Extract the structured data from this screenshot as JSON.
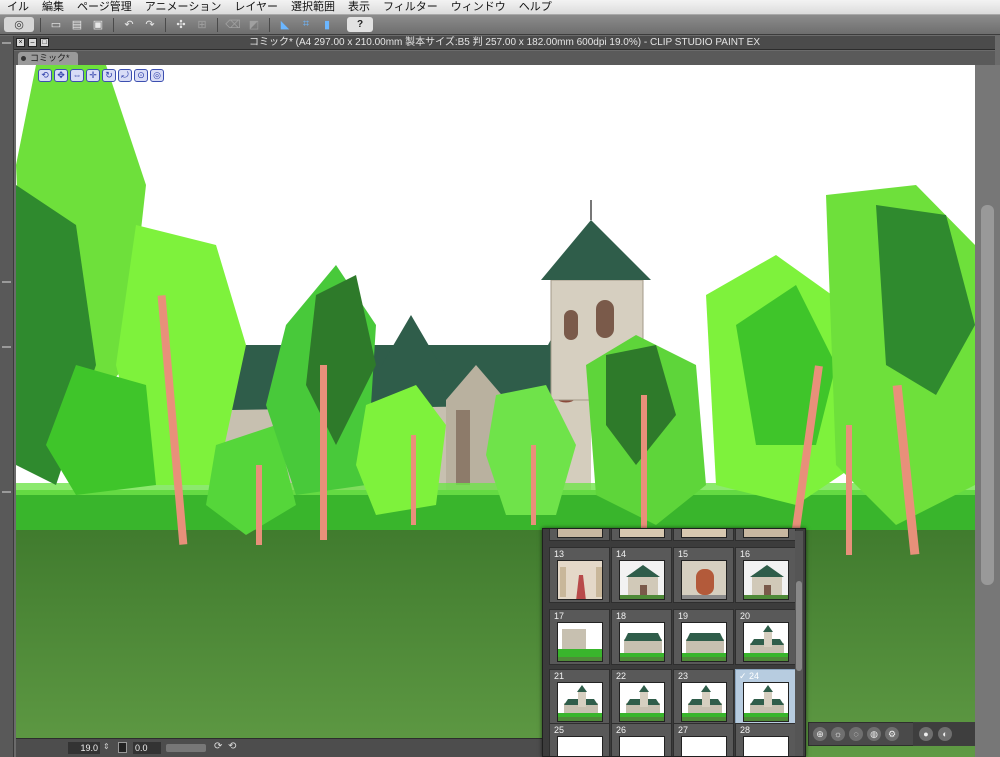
{
  "menubar": {
    "items": [
      "イル",
      "編集",
      "ページ管理",
      "アニメーション",
      "レイヤー",
      "選択範囲",
      "表示",
      "フィルター",
      "ウィンドウ",
      "ヘルプ"
    ]
  },
  "toolbar": {
    "buttons": [
      "app-logo-icon",
      "new-file-icon",
      "open-folder-icon",
      "save-icon",
      "undo-icon",
      "redo-icon",
      "transform-icon",
      "move-icon",
      "clear-icon",
      "fill-icon",
      "snap-ruler-icon",
      "snap-grid-icon",
      "snap-special-icon",
      "help-icon"
    ],
    "help_label": "?"
  },
  "window": {
    "title": "コミック* (A4 297.00 x 210.00mm 製本サイズ:B5 判 257.00 x 182.00mm 600dpi 19.0%)  - CLIP STUDIO PAINT EX",
    "tab_label": "コミック*"
  },
  "statusbar": {
    "zoom": "19.0",
    "rotation": "0.0"
  },
  "asset_panel": {
    "cells": [
      {
        "label": "",
        "scene": "interior-red"
      },
      {
        "label": "",
        "scene": "interior-beam"
      },
      {
        "label": "",
        "scene": "interior-beam"
      },
      {
        "label": "",
        "scene": "interior-red"
      },
      {
        "label": "13",
        "scene": "aisle"
      },
      {
        "label": "14",
        "scene": "facade"
      },
      {
        "label": "15",
        "scene": "door"
      },
      {
        "label": "16",
        "scene": "facade"
      },
      {
        "label": "17",
        "scene": "hedge"
      },
      {
        "label": "18",
        "scene": "church"
      },
      {
        "label": "19",
        "scene": "church"
      },
      {
        "label": "20",
        "scene": "church-tower"
      },
      {
        "label": "21",
        "scene": "church-tower"
      },
      {
        "label": "22",
        "scene": "church-tower"
      },
      {
        "label": "23",
        "scene": "church-tower"
      },
      {
        "label": "24",
        "scene": "church-tower",
        "selected": true,
        "check": "✓"
      },
      {
        "label": "25",
        "scene": "sky"
      },
      {
        "label": "26",
        "scene": "sky"
      },
      {
        "label": "27",
        "scene": "sky"
      },
      {
        "label": "28",
        "scene": "sky"
      }
    ]
  },
  "colors": {
    "sky": "#ffffff",
    "grass": "#4f8a38",
    "tree_light": "#7ef23c",
    "tree_mid": "#3fc52a",
    "tree_dark": "#2e7a2a",
    "trunk": "#e8907a",
    "roof": "#2f5d4a",
    "stone": "#c7c0b0"
  }
}
